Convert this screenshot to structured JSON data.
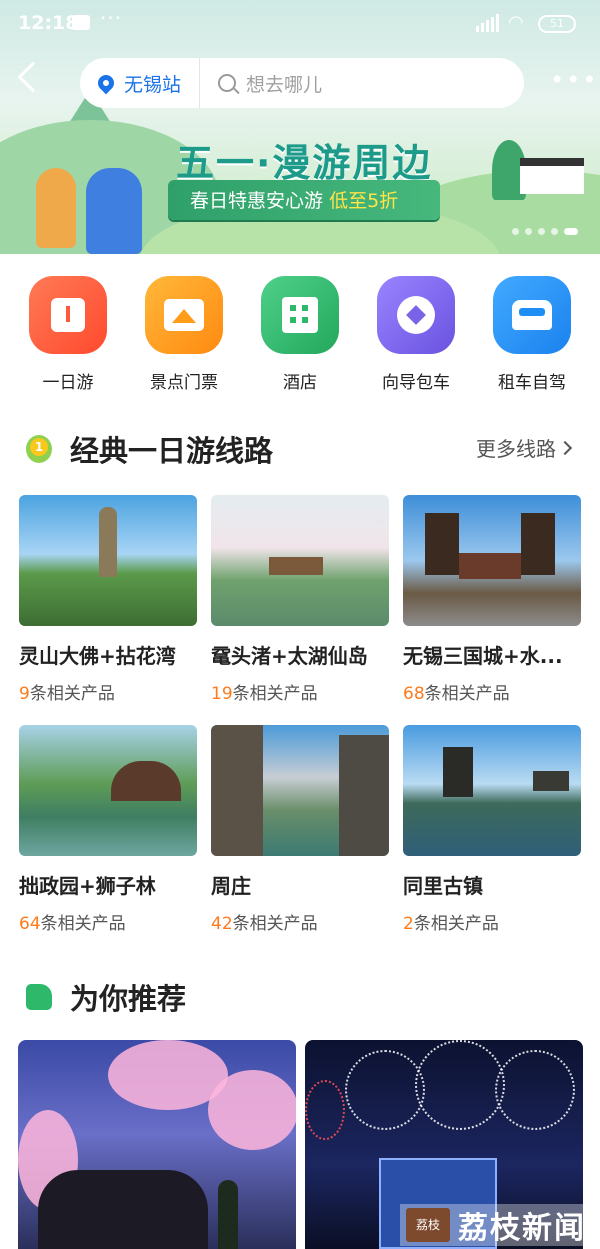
{
  "status_bar": {
    "time": "12:18",
    "network": "HD",
    "battery": "51"
  },
  "header": {
    "location": "无锡站",
    "search_placeholder": "想去哪儿"
  },
  "banner": {
    "headline": "五一·漫游周边",
    "ribbon_text": "春日特惠安心游",
    "ribbon_highlight": "低至5折"
  },
  "categories": [
    {
      "label": "一日游",
      "icon": "calendar-icon",
      "color": "#ff5a3c"
    },
    {
      "label": "景点门票",
      "icon": "ticket-icon",
      "color": "#ff9c1a"
    },
    {
      "label": "酒店",
      "icon": "hotel-icon",
      "color": "#2db86a"
    },
    {
      "label": "向导包车",
      "icon": "guide-icon",
      "color": "#7b63e8"
    },
    {
      "label": "租车自驾",
      "icon": "car-icon",
      "color": "#1f8ff5"
    }
  ],
  "routes_section": {
    "title": "经典一日游线路",
    "badge": "1",
    "more_label": "更多线路",
    "product_suffix": "条相关产品",
    "routes": [
      {
        "title": "灵山大佛+拈花湾",
        "count": "9"
      },
      {
        "title": "鼋头渚+太湖仙岛",
        "count": "19"
      },
      {
        "title": "无锡三国城+水...",
        "count": "68"
      },
      {
        "title": "拙政园+狮子林",
        "count": "64"
      },
      {
        "title": "周庄",
        "count": "42"
      },
      {
        "title": "同里古镇",
        "count": "2"
      }
    ]
  },
  "recommend_section": {
    "title": "为你推荐"
  },
  "watermark": {
    "seal": "荔枝",
    "text": "荔枝新闻"
  },
  "colors": {
    "accent": "#1a73e8",
    "count_highlight": "#ff7a1a",
    "brand_green": "#2db86a"
  }
}
